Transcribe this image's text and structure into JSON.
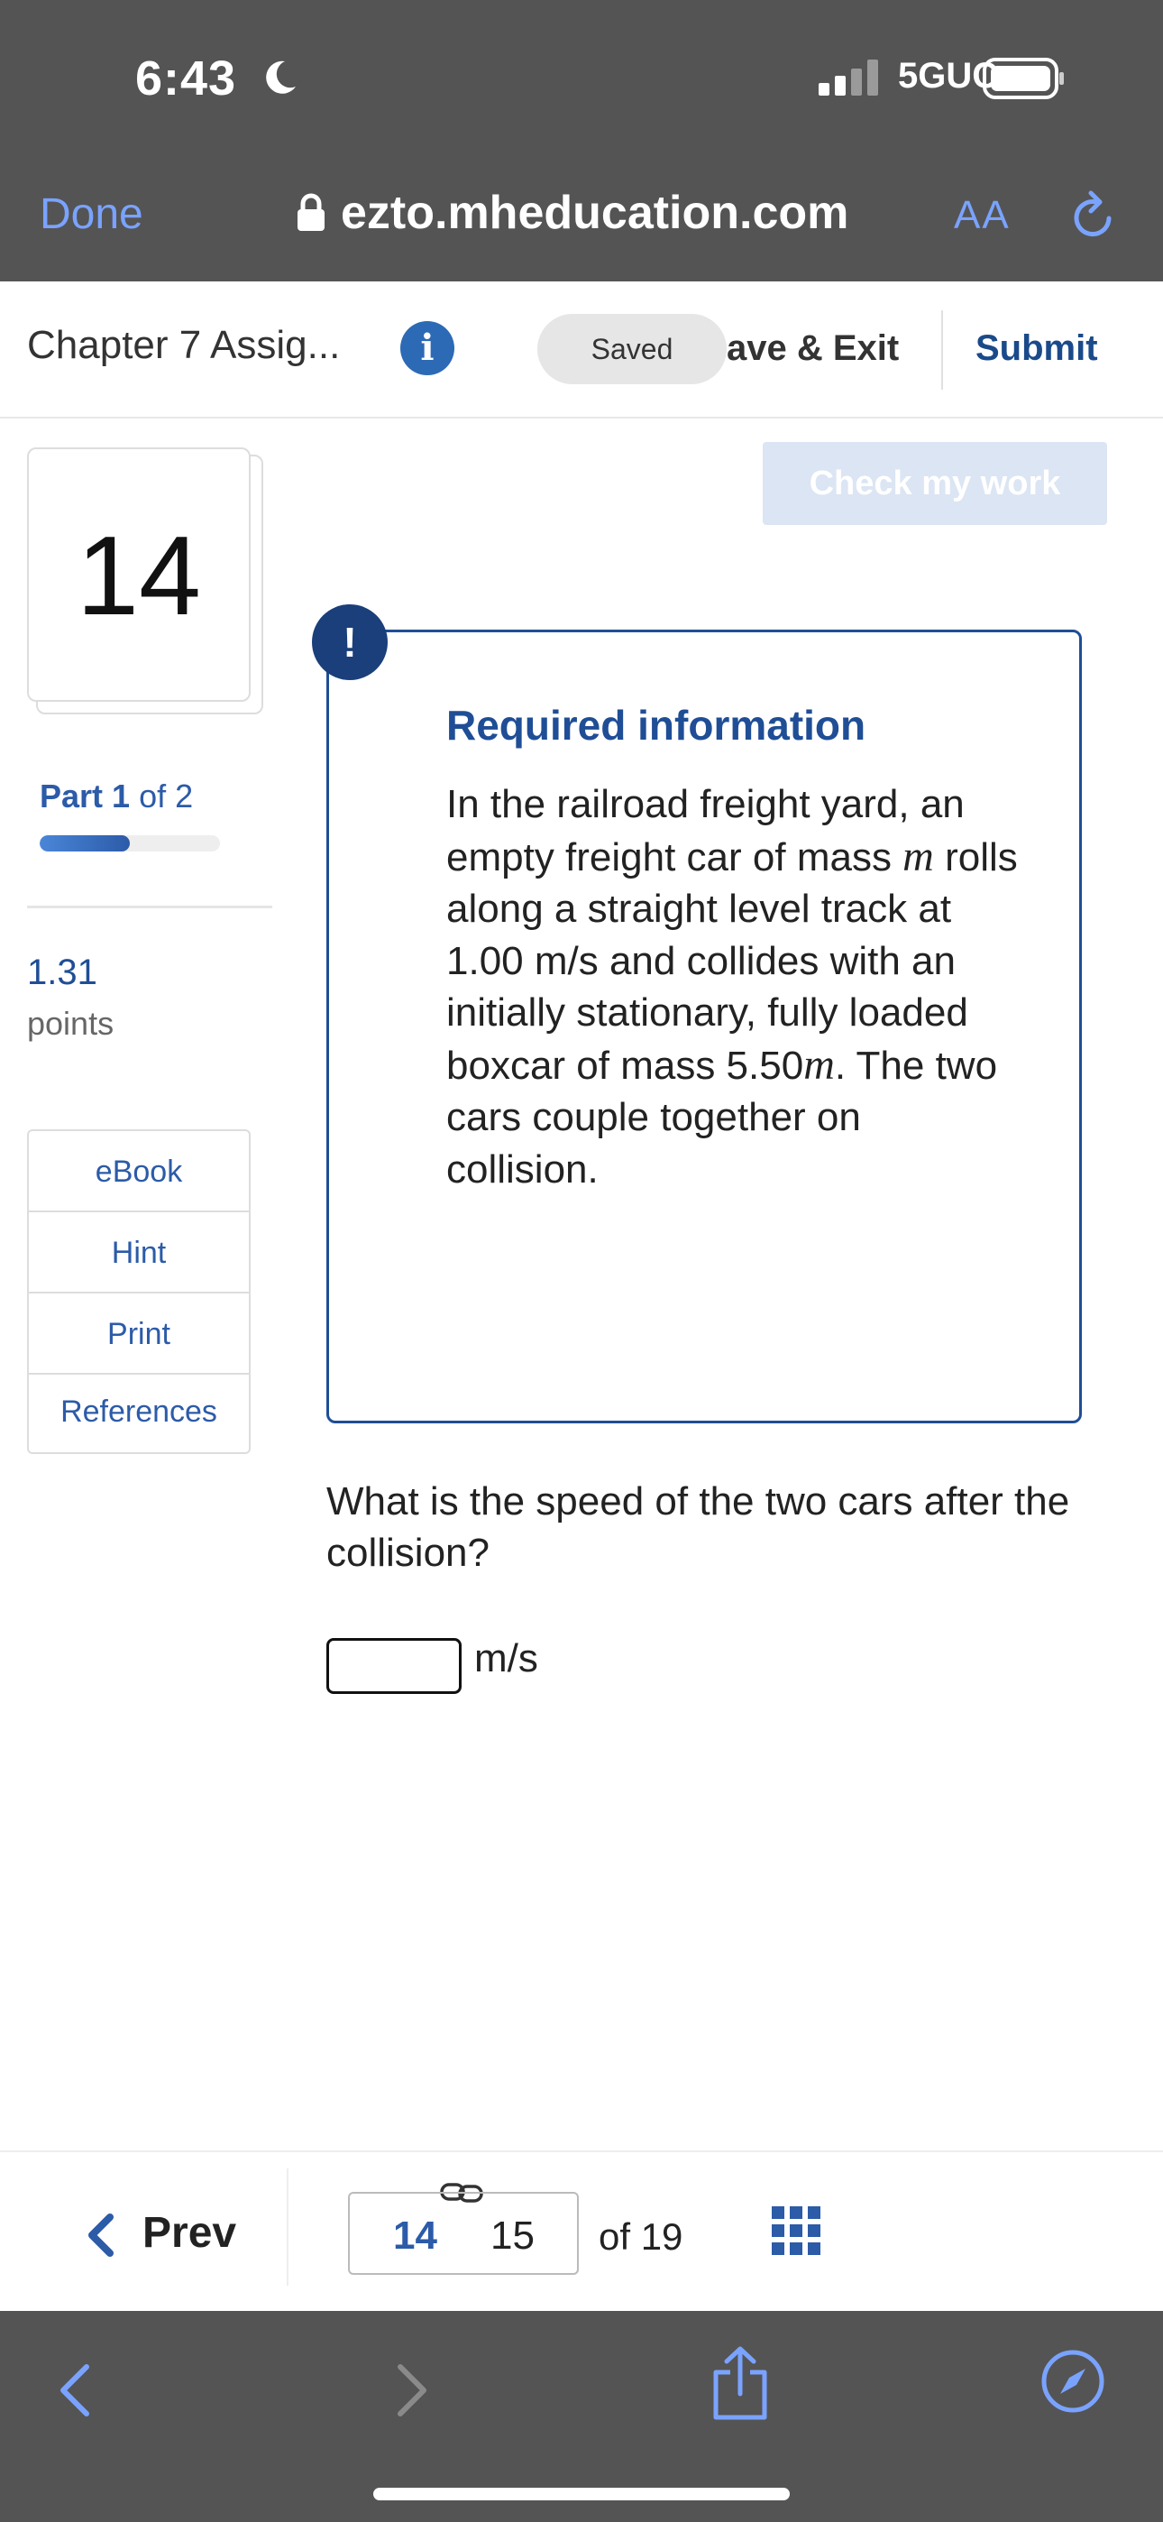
{
  "status_bar": {
    "time": "6:43",
    "network": "5GUC"
  },
  "browser": {
    "done_label": "Done",
    "url": "ezto.mheducation.com",
    "text_size_label": "AA"
  },
  "header": {
    "assignment_title": "Chapter 7 Assig...",
    "saved_label": "Saved",
    "save_exit_label": "ave & Exit",
    "submit_label": "Submit"
  },
  "check_work_label": "Check my work",
  "sidebar": {
    "question_number": "14",
    "part_word": "Part",
    "part_current": "1",
    "part_of": "of 2",
    "part_progress": 0.5,
    "points_value": "1.31",
    "points_label": "points",
    "tools": [
      "eBook",
      "Hint",
      "Print",
      "References"
    ]
  },
  "required_info": {
    "badge": "!",
    "title": "Required information",
    "text_1": "In the railroad freight yard, an empty freight car of mass ",
    "var_m": "m",
    "text_2": " rolls along a straight level track at 1.00 m/s and collides with an initially stationary, fully loaded boxcar of mass 5.50",
    "text_3": ". The two cars couple together on collision."
  },
  "question": {
    "prompt": "What is the speed of the two cars after the collision?",
    "answer_value": "",
    "unit": "m/s"
  },
  "footer": {
    "prev_label": "Prev",
    "current_page": "14",
    "next_page": "15",
    "of_total": "of  19"
  },
  "colors": {
    "brand_blue": "#1f4e96",
    "link_blue": "#2c5ba8",
    "safari_blue": "#7aa3ff",
    "chrome_gray": "#545454"
  }
}
